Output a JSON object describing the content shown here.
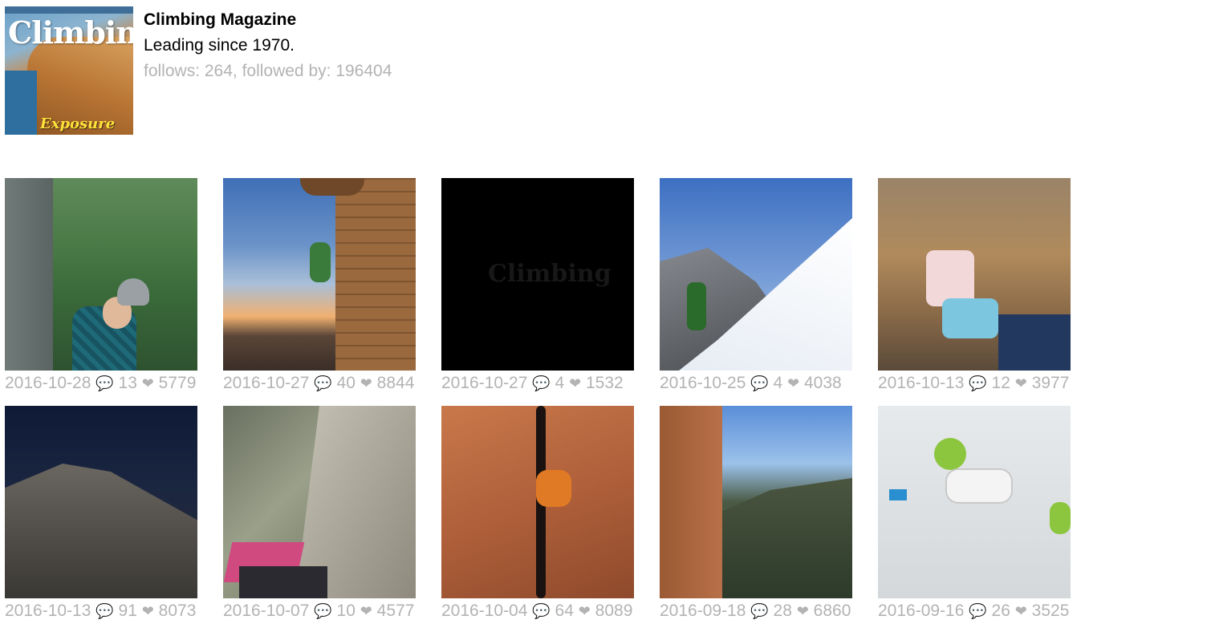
{
  "profile": {
    "name": "Climbing Magazine",
    "bio": "Leading since 1970.",
    "stats": "follows: 264, followed by: 196404",
    "avatar": {
      "logo_text": "Climbing",
      "cover_subtitle": "Exposure"
    }
  },
  "icons": {
    "comment": "speech-bubble-icon",
    "like": "heart-icon"
  },
  "posts": [
    {
      "date": "2016-10-28",
      "comments": "13",
      "likes": "5779"
    },
    {
      "date": "2016-10-27",
      "comments": "40",
      "likes": "8844"
    },
    {
      "date": "2016-10-27",
      "comments": "4",
      "likes": "1532"
    },
    {
      "date": "2016-10-25",
      "comments": "4",
      "likes": "4038"
    },
    {
      "date": "2016-10-13",
      "comments": "12",
      "likes": "3977"
    },
    {
      "date": "2016-10-13",
      "comments": "91",
      "likes": "8073"
    },
    {
      "date": "2016-10-07",
      "comments": "10",
      "likes": "4577"
    },
    {
      "date": "2016-10-04",
      "comments": "64",
      "likes": "8089"
    },
    {
      "date": "2016-09-18",
      "comments": "28",
      "likes": "6860"
    },
    {
      "date": "2016-09-16",
      "comments": "26",
      "likes": "3525"
    }
  ],
  "photo_ghost_text": "Climbing"
}
